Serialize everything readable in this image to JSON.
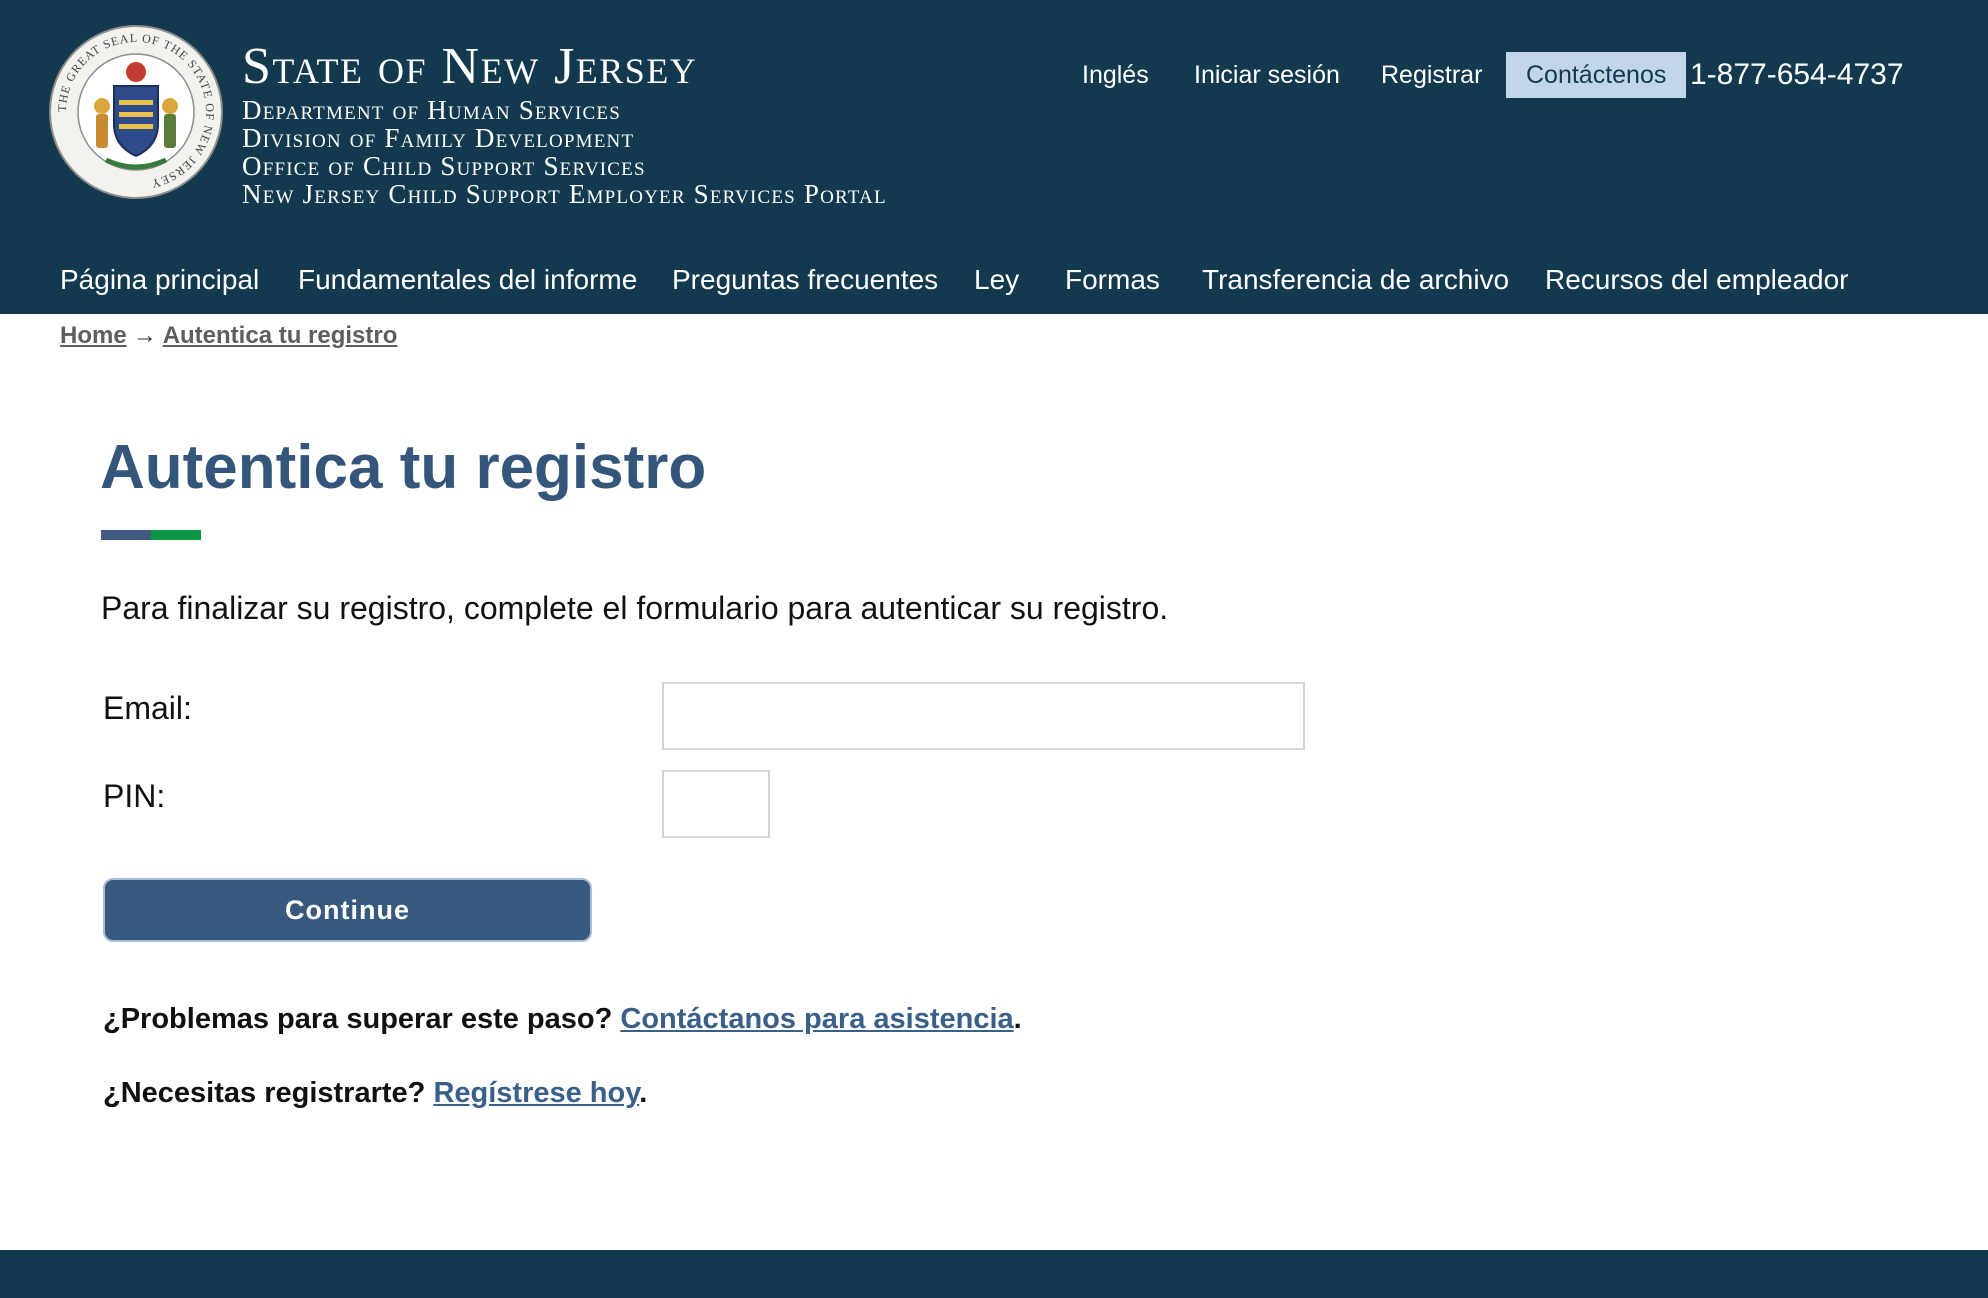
{
  "header": {
    "title": "State of New Jersey",
    "lines": [
      "Department of Human Services",
      "Division of Family Development",
      "Office of Child Support Services",
      "New Jersey Child Support Employer Services Portal"
    ],
    "seal_text": "THE GREAT SEAL OF THE STATE OF NEW JERSEY"
  },
  "utility_nav": {
    "language": "Inglés",
    "login": "Iniciar sesión",
    "register": "Registrar",
    "contact": "Contáctenos",
    "phone": "1-877-654-4737"
  },
  "main_nav": {
    "items": [
      "Página principal",
      "Fundamentales del informe",
      "Preguntas frecuentes",
      "Ley",
      "Formas",
      "Transferencia de archivo",
      "Recursos del empleador"
    ]
  },
  "breadcrumb": {
    "home": "Home",
    "separator": "→",
    "current": "Autentica tu registro"
  },
  "page": {
    "title": "Autentica tu registro",
    "intro": "Para finalizar su registro, complete el formulario para autenticar su registro."
  },
  "form": {
    "email_label": "Email:",
    "email_value": "",
    "pin_label": "PIN:",
    "pin_value": "",
    "submit_label": "Continue"
  },
  "help": {
    "problems_text": "¿Problemas para superar este paso?",
    "problems_link": "Contáctanos para asistencia",
    "register_text": "¿Necesitas registrarte?",
    "register_link": "Regístrese hoy",
    "period": "."
  },
  "colors": {
    "header_bg": "#13394f",
    "title_blue": "#34567a",
    "accent_blue": "#3f5c80",
    "accent_green": "#0c9747",
    "button_bg": "#37597e",
    "link": "#3a5f89",
    "contact_bg": "#c2d6ea"
  },
  "icons": {
    "seal": "nj-state-seal-icon"
  }
}
